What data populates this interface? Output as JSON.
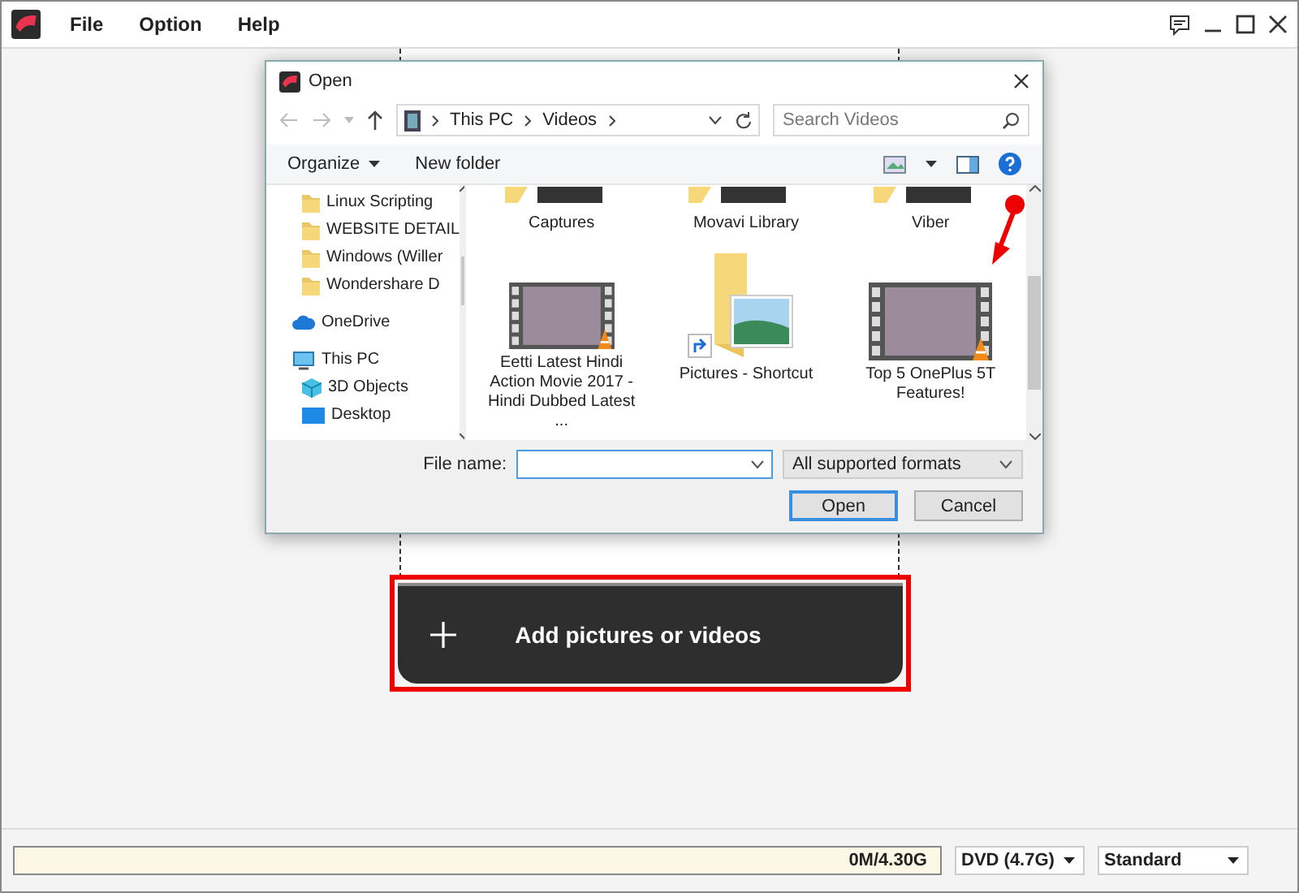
{
  "menu": [
    {
      "label": "File"
    },
    {
      "label": "Option"
    },
    {
      "label": "Help"
    }
  ],
  "dialog": {
    "title": "Open",
    "path": [
      "This PC",
      "Videos"
    ],
    "search": {
      "placeholder": "Search Videos"
    },
    "toolbar": [
      "Organize",
      "New folder"
    ],
    "nav": [
      {
        "label": "Linux Scripting",
        "kind": "folder"
      },
      {
        "label": "WEBSITE DETAIL",
        "kind": "folder"
      },
      {
        "label": "Windows (Willer",
        "kind": "folder"
      },
      {
        "label": "Wondershare D",
        "kind": "folder"
      },
      {
        "label": "OneDrive",
        "kind": "cloud"
      },
      {
        "label": "This PC",
        "kind": "pc",
        "children": [
          {
            "label": "3D Objects",
            "kind": "cube"
          },
          {
            "label": "Desktop",
            "kind": "desktop"
          }
        ]
      }
    ],
    "files": [
      {
        "label": "Captures",
        "kind": "folder-cut"
      },
      {
        "label": "Movavi Library",
        "kind": "folder-cut"
      },
      {
        "label": "Viber",
        "kind": "folder-cut"
      },
      {
        "label": "Eetti Latest Hindi Action Movie 2017 - Hindi Dubbed Latest ...",
        "kind": "video"
      },
      {
        "label": "Pictures - Shortcut",
        "kind": "shortcut"
      },
      {
        "label": "Top 5 OnePlus 5T Features!",
        "kind": "video",
        "marked": true
      }
    ],
    "file_name": {
      "label": "File name:"
    },
    "filter": "All supported formats",
    "buttons": [
      {
        "label": "Open",
        "kind": "default"
      },
      {
        "label": "Cancel",
        "kind": "normal"
      }
    ]
  },
  "add_button": {
    "label": "Add pictures or videos",
    "highlighted": true
  },
  "storage": {
    "level": 0,
    "reading": "0M/4.30G"
  },
  "disc": "DVD (4.7G)",
  "quality": "Standard"
}
